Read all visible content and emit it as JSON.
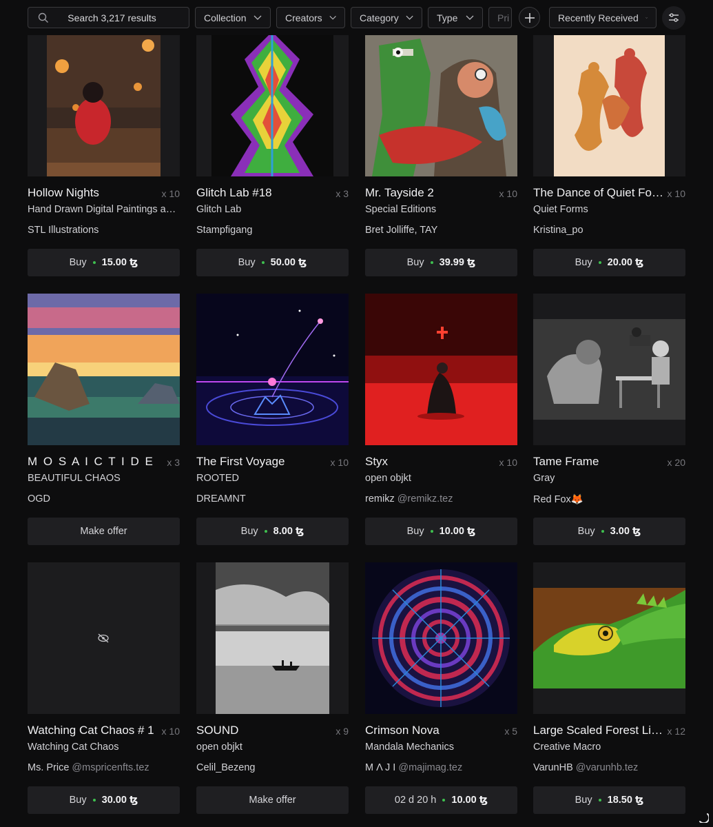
{
  "toolbar": {
    "search_placeholder": "Search 3,217 results",
    "filters": {
      "collection": "Collection",
      "creators": "Creators",
      "category": "Category",
      "type": "Type",
      "price": "Pri"
    },
    "sort": "Recently Received",
    "icons": [
      "search-icon",
      "chevron-down-icon",
      "plus-icon",
      "sliders-icon"
    ]
  },
  "currency_symbol": "ꜩ",
  "cards": [
    {
      "title": "Hollow Nights",
      "qty": "x 10",
      "collection": "Hand Drawn Digital Paintings and Animations",
      "creator": "STL Illustrations",
      "handle": "",
      "action": "Buy",
      "price": "15.00"
    },
    {
      "title": "Glitch Lab #18",
      "qty": "x 3",
      "collection": "Glitch Lab",
      "creator": "Stampfigang",
      "handle": "",
      "action": "Buy",
      "price": "50.00"
    },
    {
      "title": "Mr. Tayside 2",
      "qty": "x 10",
      "collection": "Special Editions",
      "creator": "Bret Jolliffe, TAY",
      "handle": "",
      "action": "Buy",
      "price": "39.99"
    },
    {
      "title": "The Dance of Quiet Forms",
      "qty": "x 10",
      "collection": "Quiet Forms",
      "creator": "Kristina_po",
      "handle": "",
      "action": "Buy",
      "price": "20.00"
    },
    {
      "title": "M O S A I C T I D E",
      "qty": "x 3",
      "collection": "BEAUTIFUL CHAOS",
      "creator": "OGD",
      "handle": "",
      "action": "Make offer",
      "price": ""
    },
    {
      "title": "The First Voyage",
      "qty": "x 10",
      "collection": "ROOTED",
      "creator": "DREAMNT",
      "handle": "",
      "action": "Buy",
      "price": "8.00"
    },
    {
      "title": "Styx",
      "qty": "x 10",
      "collection": "open objkt",
      "creator": "remikz",
      "handle": "@remikz.tez",
      "action": "Buy",
      "price": "10.00"
    },
    {
      "title": "Tame Frame",
      "qty": "x 20",
      "collection": "Gray",
      "creator": "Red Fox🦊",
      "handle": "",
      "action": "Buy",
      "price": "3.00"
    },
    {
      "title": "Watching Cat Chaos # 1",
      "qty": "x 10",
      "collection": "Watching Cat Chaos",
      "creator": "Ms. Price",
      "handle": "@mspricenfts.tez",
      "action": "Buy",
      "price": "30.00",
      "hidden_image": true
    },
    {
      "title": "SOUND",
      "qty": "x 9",
      "collection": "open objkt",
      "creator": "Celil_Bezeng",
      "handle": "",
      "action": "Make offer",
      "price": ""
    },
    {
      "title": "Crimson Nova",
      "qty": "x 5",
      "collection": "Mandala Mechanics",
      "creator": "M Λ J I",
      "handle": "@majimag.tez",
      "action": "02 d  20 h",
      "price": "10.00"
    },
    {
      "title": "Large Scaled Forest Lizard",
      "qty": "x 12",
      "collection": "Creative Macro",
      "creator": "VarunHB",
      "handle": "@varunhb.tez",
      "action": "Buy",
      "price": "18.50"
    }
  ],
  "colors": {
    "background": "#0d0d0e",
    "button": "#1f1f22",
    "price_dot": "#3fbf4f"
  }
}
